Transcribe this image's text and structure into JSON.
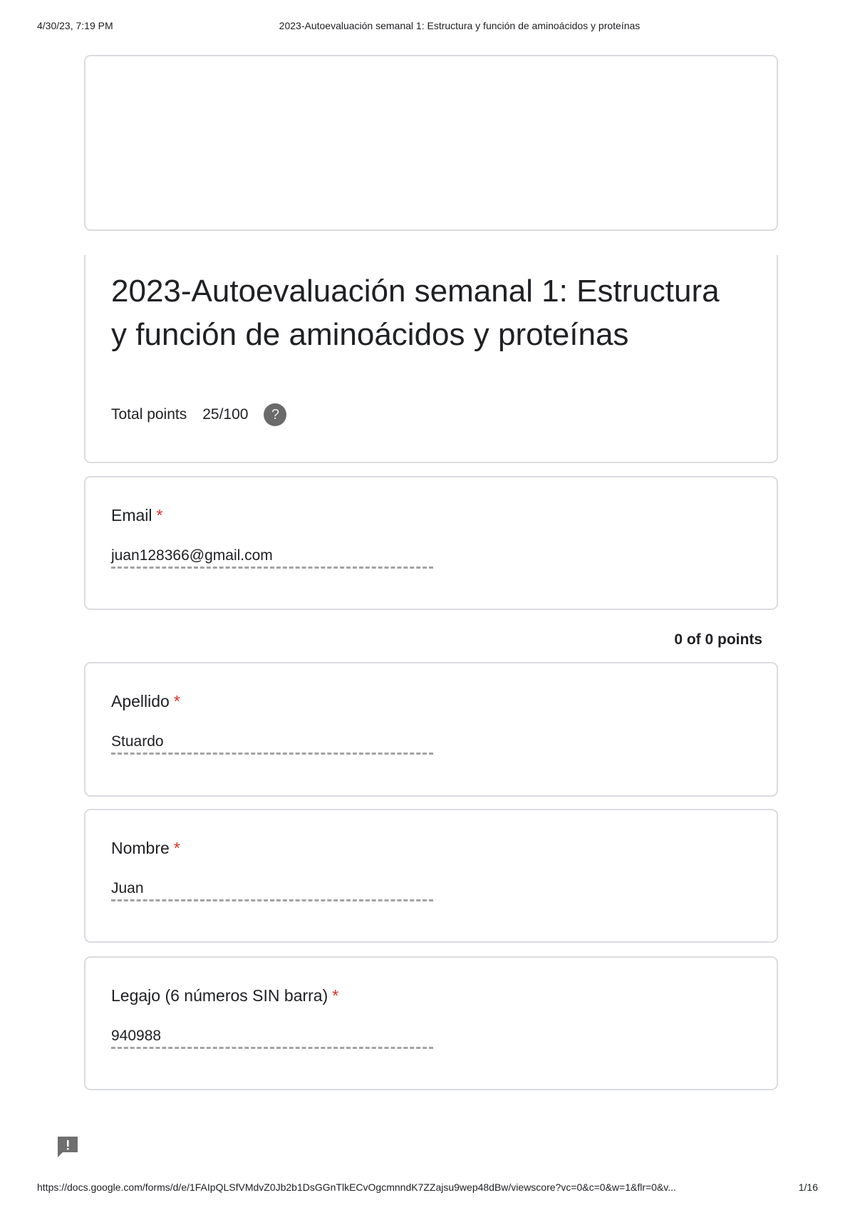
{
  "print_header": {
    "datetime": "4/30/23, 7:19 PM",
    "doc_title": "2023-Autoevaluación semanal 1: Estructura y función de aminoácidos y proteínas"
  },
  "form": {
    "title": "2023-Autoevaluación semanal 1: Estructura y función de aminoácidos y proteínas",
    "total_points_label": "Total points",
    "total_points_value": "25/100",
    "help_icon_glyph": "?"
  },
  "section": {
    "points": "0 of 0 points"
  },
  "questions": [
    {
      "label": "Email",
      "required": "*",
      "answer": "juan128366@gmail.com"
    },
    {
      "label": "Apellido",
      "required": "*",
      "answer": "Stuardo"
    },
    {
      "label": "Nombre",
      "required": "*",
      "answer": "Juan"
    },
    {
      "label": "Legajo (6 números SIN barra)",
      "required": "*",
      "answer": "940988"
    }
  ],
  "print_footer": {
    "url": "https://docs.google.com/forms/d/e/1FAIpQLSfVMdvZ0Jb2b1DsGGnTlkECvOgcmnndK7ZZajsu9wep48dBw/viewscore?vc=0&c=0&w=1&flr=0&v...",
    "page": "1/16"
  },
  "colors": {
    "border": "#dadce0",
    "required": "#d93025",
    "text": "#202124",
    "icon_gray": "#6a6a6a"
  },
  "icons": {
    "help": "help-circle-icon",
    "feedback": "report-feedback-icon"
  }
}
